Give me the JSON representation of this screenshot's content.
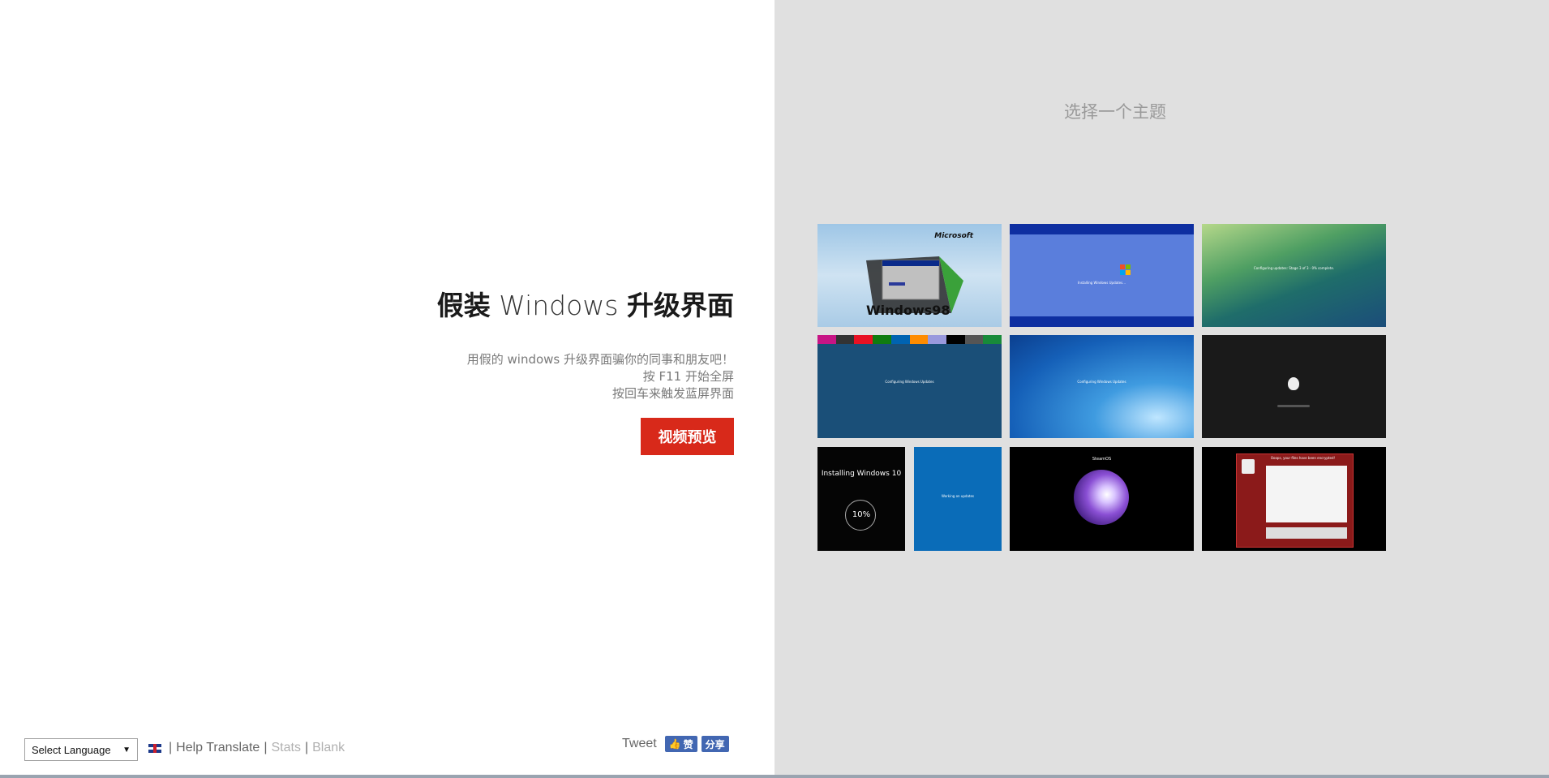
{
  "left": {
    "title_cn_1": "假装",
    "title_en": "Windows",
    "title_cn_2": "升级界面",
    "desc_line1": "用假的 windows 升级界面骗你的同事和朋友吧！",
    "desc_line2": "按 F11 开始全屏",
    "desc_line3": "按回车来触发蓝屏界面",
    "preview_button": "视频预览"
  },
  "footer": {
    "language_select": "Select Language",
    "separator": "|",
    "help_translate": "Help Translate",
    "stats": "Stats",
    "blank": "Blank",
    "tweet": "Tweet",
    "fb_like": "赞",
    "fb_share": "分享"
  },
  "right": {
    "theme_title": "选择一个主题",
    "themes": {
      "win98": {
        "brand": "Microsoft",
        "logo_text": "Windows98"
      },
      "winxp": {
        "text": "Installing Windows Updates..."
      },
      "vista": {
        "text": "Configuring updates: Stage 3 of 3 - 0% complete."
      },
      "win8": {
        "text": "Configuring Windows Updates"
      },
      "win7": {
        "text": "Configuring Windows Updates"
      },
      "macos": {},
      "win10": {
        "title": "Installing Windows 10",
        "percent": "10%"
      },
      "win10blue": {
        "text": "Working on updates"
      },
      "steam": {
        "text": "SteamOS"
      },
      "ransomware": {
        "text": "Ooops, your files have been encrypted!"
      }
    }
  },
  "colors": {
    "accent": "#d8291a",
    "right_bg": "#e0e0e0",
    "facebook": "#4267b2"
  }
}
